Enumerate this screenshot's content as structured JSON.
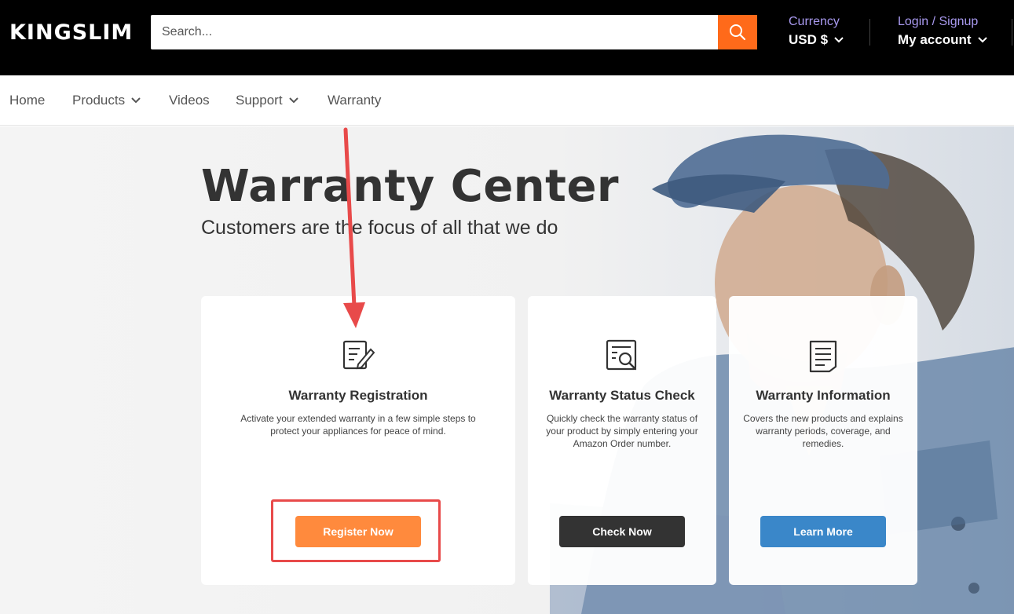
{
  "header": {
    "logo": "KINGSLIM",
    "search_placeholder": "Search...",
    "currency_label": "Currency",
    "currency_value": "USD $",
    "login_label": "Login / Signup",
    "account_label": "My account"
  },
  "nav": {
    "items": [
      {
        "label": "Home"
      },
      {
        "label": "Products"
      },
      {
        "label": "Videos"
      },
      {
        "label": "Support"
      },
      {
        "label": "Warranty"
      }
    ]
  },
  "hero": {
    "title": "Warranty Center",
    "subtitle": "Customers are the focus of all that we do"
  },
  "cards": [
    {
      "icon": "edit-document-icon",
      "title": "Warranty Registration",
      "desc_line1": "Activate your extended warranty in a few simple steps to",
      "desc_line2": "protect your appliances for peace of mind.",
      "desc_line3": "",
      "button": "Register Now",
      "button_color": "#ff8a3d"
    },
    {
      "icon": "document-search-icon",
      "title": "Warranty Status Check",
      "desc_line1": "Quickly check the warranty status of",
      "desc_line2": "your product by simply entering your",
      "desc_line3": "Amazon Order number.",
      "button": "Check Now",
      "button_color": "#333333"
    },
    {
      "icon": "document-info-icon",
      "title": "Warranty Information",
      "desc_line1": "Covers the new products and explains",
      "desc_line2": "warranty periods, coverage, and",
      "desc_line3": "remedies.",
      "button": "Learn More",
      "button_color": "#3a87c9"
    }
  ],
  "colors": {
    "accent_orange": "#ff6a1a",
    "annotation_red": "#e84a4a"
  }
}
